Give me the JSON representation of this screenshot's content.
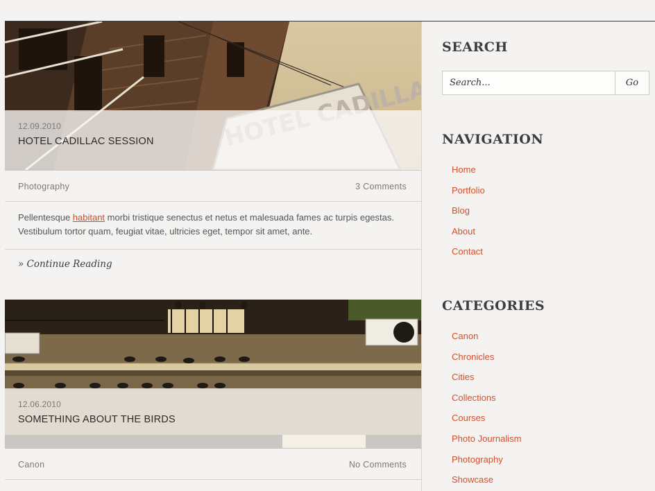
{
  "posts": [
    {
      "date": "12.09.2010",
      "title": "HOTEL CADILLAC SESSION",
      "sign_text": "HOTEL CADILLAC",
      "category": "Photography",
      "comments": "3 Comments",
      "excerpt": {
        "before": "Pellentesque ",
        "link": "habitant",
        "after": " morbi tristique senectus et netus et malesuada fames ac turpis egestas. Vestibulum tortor quam, feugiat vitae, ultricies eget, tempor sit amet, ante."
      },
      "continue_label": "» Continue Reading"
    },
    {
      "date": "12.06.2010",
      "title": "SOMETHING ABOUT THE BIRDS",
      "category": "Canon",
      "comments": "No Comments"
    }
  ],
  "sidebar": {
    "search": {
      "title": "SEARCH",
      "placeholder": "Search...",
      "button_label": "Go"
    },
    "navigation": {
      "title": "NAVIGATION",
      "items": [
        "Home",
        "Portfolio",
        "Blog",
        "About",
        "Contact"
      ]
    },
    "categories": {
      "title": "CATEGORIES",
      "items": [
        "Canon",
        "Chronicles",
        "Cities",
        "Collections",
        "Courses",
        "Photo Journalism",
        "Photography",
        "Showcase"
      ]
    }
  },
  "colors": {
    "accent": "#d2502a",
    "background": "#f4f3f1",
    "text": "#444444"
  }
}
